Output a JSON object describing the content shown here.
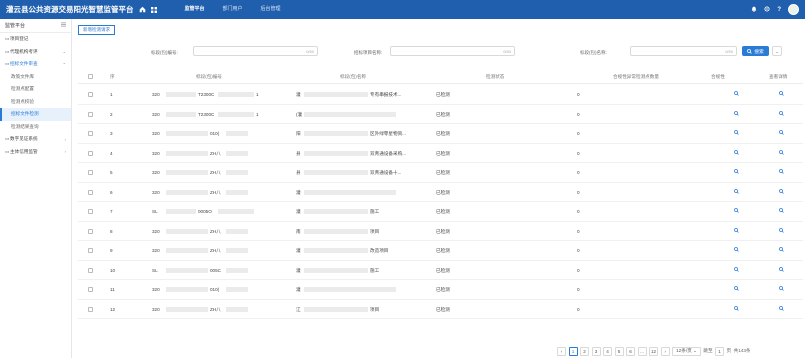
{
  "header": {
    "title": "灌云县公共资源交易阳光智慧监管平台",
    "nav": [
      "监管平台",
      "部门用户",
      "后台管理"
    ],
    "active_nav": 0,
    "icons": [
      "home-icon",
      "grid-icon",
      "bell-icon",
      "gear-icon",
      "help-icon",
      "avatar"
    ]
  },
  "sidebar": {
    "title": "监管平台",
    "items": [
      {
        "label": "项目登记",
        "level": 1,
        "icon": "doc-icon"
      },
      {
        "label": "代理机构考评",
        "level": 1,
        "icon": "doc-icon",
        "arrow": "⌄"
      },
      {
        "label": "招标文件审查",
        "level": 1,
        "icon": "doc-icon",
        "arrow": "⌃",
        "group": true
      },
      {
        "label": "政策文件库",
        "level": 2
      },
      {
        "label": "检测点配置",
        "level": 2
      },
      {
        "label": "检测点校验",
        "level": 2
      },
      {
        "label": "招标文件检测",
        "level": 2,
        "active": true
      },
      {
        "label": "检测结果查询",
        "level": 2
      },
      {
        "label": "数字见证系统",
        "level": 1,
        "icon": "doc-icon",
        "arrow": "›"
      },
      {
        "label": "主体信用监管",
        "level": 1,
        "icon": "doc-icon",
        "arrow": "›"
      }
    ]
  },
  "toolbar": {
    "new_request_label": "新增检测请求"
  },
  "filters": [
    {
      "label": "标段(包)编号:",
      "counter": "0/50"
    },
    {
      "label": "招标项目名称:",
      "counter": "0/50"
    },
    {
      "label": "标段(包)名称:",
      "counter": "0/50"
    }
  ],
  "search_label": "搜索",
  "table": {
    "headers": [
      "序",
      "标段(包)编号",
      "标段(包)名称",
      "检测状态",
      "合规性异常检测点数量",
      "合规性",
      "查看详情"
    ],
    "rows": [
      {
        "no": "1",
        "code_pre": "320",
        "code_mid": "T2300C",
        "code_suf": "1",
        "name_pre": "灌",
        "name_suf": "专有串报技术...",
        "status": "已检测",
        "count": "0"
      },
      {
        "no": "2",
        "code_pre": "320",
        "code_mid": "T2300C",
        "code_suf": "1",
        "name_pre": "(灌",
        "name_suf": "",
        "status": "已检测",
        "count": "0"
      },
      {
        "no": "3",
        "code_pre": "320",
        "code_mid": "010(",
        "code_suf": "",
        "name_pre": "阳",
        "name_suf": "区外绿零星物资...",
        "status": "已检测",
        "count": "0"
      },
      {
        "no": "4",
        "code_pre": "320",
        "code_mid": "ZH八",
        "code_suf": "",
        "name_pre": "县",
        "name_suf": "双青通设备采购...",
        "status": "已检测",
        "count": "0"
      },
      {
        "no": "5",
        "code_pre": "320",
        "code_mid": "ZH八",
        "code_suf": "",
        "name_pre": "县",
        "name_suf": "双青通设备十...",
        "status": "已检测",
        "count": "0"
      },
      {
        "no": "6",
        "code_pre": "320",
        "code_mid": "ZH八",
        "code_suf": "",
        "name_pre": "灌",
        "name_suf": "",
        "status": "已检测",
        "count": "0"
      },
      {
        "no": "7",
        "code_pre": "SL",
        "code_mid": "0005O",
        "code_suf": "",
        "name_pre": "灌",
        "name_suf": "施工",
        "status": "已检测",
        "count": "0"
      },
      {
        "no": "8",
        "code_pre": "320",
        "code_mid": "ZH八",
        "code_suf": "",
        "name_pre": "南",
        "name_suf": "项目",
        "status": "已检测",
        "count": "0"
      },
      {
        "no": "9",
        "code_pre": "320",
        "code_mid": "ZH八",
        "code_suf": "",
        "name_pre": "灌",
        "name_suf": "改造项目",
        "status": "已检测",
        "count": "0"
      },
      {
        "no": "10",
        "code_pre": "SL",
        "code_mid": "005C",
        "code_suf": "",
        "name_pre": "灌",
        "name_suf": "施工",
        "status": "已检测",
        "count": "0"
      },
      {
        "no": "11",
        "code_pre": "320",
        "code_mid": "010(",
        "code_suf": "",
        "name_pre": "灌",
        "name_suf": "",
        "status": "已检测",
        "count": "0"
      },
      {
        "no": "12",
        "code_pre": "320",
        "code_mid": "ZH八",
        "code_suf": "",
        "name_pre": "江",
        "name_suf": "项目",
        "status": "已检测",
        "count": "0"
      }
    ]
  },
  "pagination": {
    "prev": "‹",
    "pages": [
      "1",
      "2",
      "3",
      "4",
      "5",
      "6",
      "...",
      "12"
    ],
    "active": 0,
    "next": "›",
    "page_size": "12条/页",
    "jump_label": "跳至",
    "jump_value": "1",
    "page_unit": "页",
    "total": "共143条"
  }
}
